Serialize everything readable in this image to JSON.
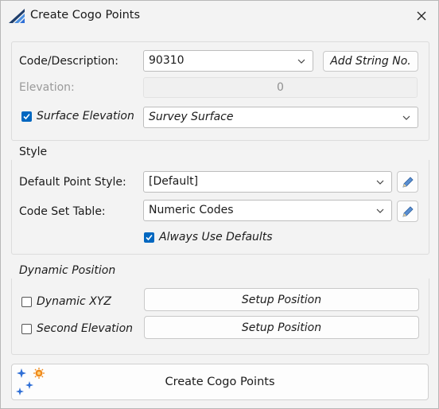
{
  "window": {
    "title": "Create Cogo Points"
  },
  "top": {
    "code_label": "Code/Description:",
    "code_value": "90310",
    "add_string_button": "Add String No.",
    "elevation_label": "Elevation:",
    "elevation_value": "0",
    "surface_elevation_label": "Surface Elevation",
    "surface_elevation_checked": true,
    "surface_value": "Survey Surface"
  },
  "style": {
    "heading": "Style",
    "default_point_style_label": "Default Point Style:",
    "default_point_style_value": "[Default]",
    "code_set_table_label": "Code Set Table:",
    "code_set_table_value": "Numeric Codes",
    "always_use_defaults_label": "Always Use Defaults",
    "always_use_defaults_checked": true
  },
  "dynamic": {
    "heading": "Dynamic Position",
    "dynamic_xyz_label": "Dynamic XYZ",
    "dynamic_xyz_checked": false,
    "second_elevation_label": "Second Elevation",
    "second_elevation_checked": false,
    "setup_position_label_1": "Setup Position",
    "setup_position_label_2": "Setup Position"
  },
  "create_button": "Create Cogo Points",
  "colors": {
    "accent": "#0067c0",
    "icon_blue": "#2f6fd6",
    "icon_orange": "#f08a1c"
  }
}
